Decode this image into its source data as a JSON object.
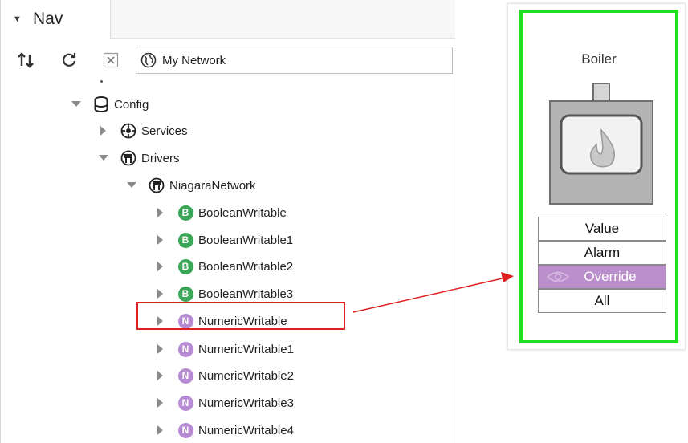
{
  "nav": {
    "title": "Nav",
    "ord_text": "My Network"
  },
  "tree": {
    "config": "Config",
    "services": "Services",
    "drivers": "Drivers",
    "niagara_network": "NiagaraNetwork",
    "points": [
      {
        "badge": "B",
        "label": "BooleanWritable"
      },
      {
        "badge": "B",
        "label": "BooleanWritable1"
      },
      {
        "badge": "B",
        "label": "BooleanWritable2"
      },
      {
        "badge": "B",
        "label": "BooleanWritable3"
      },
      {
        "badge": "N",
        "label": "NumericWritable"
      },
      {
        "badge": "N",
        "label": "NumericWritable1"
      },
      {
        "badge": "N",
        "label": "NumericWritable2"
      },
      {
        "badge": "N",
        "label": "NumericWritable3"
      },
      {
        "badge": "N",
        "label": "NumericWritable4"
      }
    ]
  },
  "widget": {
    "title": "Boiler",
    "buttons": [
      "Value",
      "Alarm",
      "Override",
      "All"
    ],
    "selected": "Override"
  },
  "colors": {
    "boolean_badge": "#3aa657",
    "numeric_badge": "#b78bd3",
    "highlight": "#e02020",
    "frame": "#1fe01f",
    "selected_button": "#bb8fcc"
  }
}
